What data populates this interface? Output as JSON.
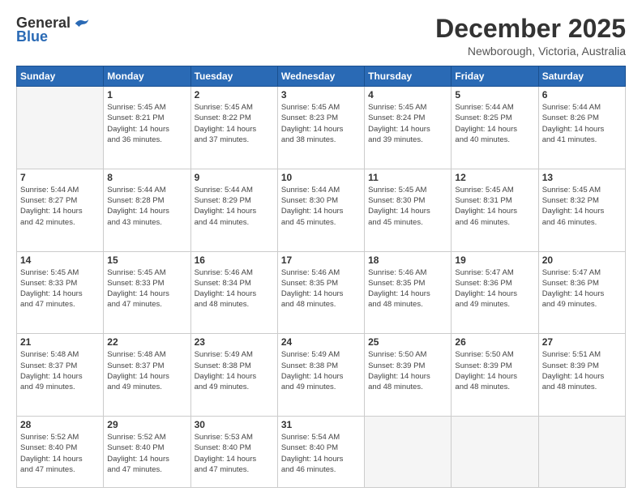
{
  "header": {
    "logo_general": "General",
    "logo_blue": "Blue",
    "month_title": "December 2025",
    "subtitle": "Newborough, Victoria, Australia"
  },
  "days_of_week": [
    "Sunday",
    "Monday",
    "Tuesday",
    "Wednesday",
    "Thursday",
    "Friday",
    "Saturday"
  ],
  "weeks": [
    [
      {
        "num": "",
        "info": ""
      },
      {
        "num": "1",
        "info": "Sunrise: 5:45 AM\nSunset: 8:21 PM\nDaylight: 14 hours\nand 36 minutes."
      },
      {
        "num": "2",
        "info": "Sunrise: 5:45 AM\nSunset: 8:22 PM\nDaylight: 14 hours\nand 37 minutes."
      },
      {
        "num": "3",
        "info": "Sunrise: 5:45 AM\nSunset: 8:23 PM\nDaylight: 14 hours\nand 38 minutes."
      },
      {
        "num": "4",
        "info": "Sunrise: 5:45 AM\nSunset: 8:24 PM\nDaylight: 14 hours\nand 39 minutes."
      },
      {
        "num": "5",
        "info": "Sunrise: 5:44 AM\nSunset: 8:25 PM\nDaylight: 14 hours\nand 40 minutes."
      },
      {
        "num": "6",
        "info": "Sunrise: 5:44 AM\nSunset: 8:26 PM\nDaylight: 14 hours\nand 41 minutes."
      }
    ],
    [
      {
        "num": "7",
        "info": "Sunrise: 5:44 AM\nSunset: 8:27 PM\nDaylight: 14 hours\nand 42 minutes."
      },
      {
        "num": "8",
        "info": "Sunrise: 5:44 AM\nSunset: 8:28 PM\nDaylight: 14 hours\nand 43 minutes."
      },
      {
        "num": "9",
        "info": "Sunrise: 5:44 AM\nSunset: 8:29 PM\nDaylight: 14 hours\nand 44 minutes."
      },
      {
        "num": "10",
        "info": "Sunrise: 5:44 AM\nSunset: 8:30 PM\nDaylight: 14 hours\nand 45 minutes."
      },
      {
        "num": "11",
        "info": "Sunrise: 5:45 AM\nSunset: 8:30 PM\nDaylight: 14 hours\nand 45 minutes."
      },
      {
        "num": "12",
        "info": "Sunrise: 5:45 AM\nSunset: 8:31 PM\nDaylight: 14 hours\nand 46 minutes."
      },
      {
        "num": "13",
        "info": "Sunrise: 5:45 AM\nSunset: 8:32 PM\nDaylight: 14 hours\nand 46 minutes."
      }
    ],
    [
      {
        "num": "14",
        "info": "Sunrise: 5:45 AM\nSunset: 8:33 PM\nDaylight: 14 hours\nand 47 minutes."
      },
      {
        "num": "15",
        "info": "Sunrise: 5:45 AM\nSunset: 8:33 PM\nDaylight: 14 hours\nand 47 minutes."
      },
      {
        "num": "16",
        "info": "Sunrise: 5:46 AM\nSunset: 8:34 PM\nDaylight: 14 hours\nand 48 minutes."
      },
      {
        "num": "17",
        "info": "Sunrise: 5:46 AM\nSunset: 8:35 PM\nDaylight: 14 hours\nand 48 minutes."
      },
      {
        "num": "18",
        "info": "Sunrise: 5:46 AM\nSunset: 8:35 PM\nDaylight: 14 hours\nand 48 minutes."
      },
      {
        "num": "19",
        "info": "Sunrise: 5:47 AM\nSunset: 8:36 PM\nDaylight: 14 hours\nand 49 minutes."
      },
      {
        "num": "20",
        "info": "Sunrise: 5:47 AM\nSunset: 8:36 PM\nDaylight: 14 hours\nand 49 minutes."
      }
    ],
    [
      {
        "num": "21",
        "info": "Sunrise: 5:48 AM\nSunset: 8:37 PM\nDaylight: 14 hours\nand 49 minutes."
      },
      {
        "num": "22",
        "info": "Sunrise: 5:48 AM\nSunset: 8:37 PM\nDaylight: 14 hours\nand 49 minutes."
      },
      {
        "num": "23",
        "info": "Sunrise: 5:49 AM\nSunset: 8:38 PM\nDaylight: 14 hours\nand 49 minutes."
      },
      {
        "num": "24",
        "info": "Sunrise: 5:49 AM\nSunset: 8:38 PM\nDaylight: 14 hours\nand 49 minutes."
      },
      {
        "num": "25",
        "info": "Sunrise: 5:50 AM\nSunset: 8:39 PM\nDaylight: 14 hours\nand 48 minutes."
      },
      {
        "num": "26",
        "info": "Sunrise: 5:50 AM\nSunset: 8:39 PM\nDaylight: 14 hours\nand 48 minutes."
      },
      {
        "num": "27",
        "info": "Sunrise: 5:51 AM\nSunset: 8:39 PM\nDaylight: 14 hours\nand 48 minutes."
      }
    ],
    [
      {
        "num": "28",
        "info": "Sunrise: 5:52 AM\nSunset: 8:40 PM\nDaylight: 14 hours\nand 47 minutes."
      },
      {
        "num": "29",
        "info": "Sunrise: 5:52 AM\nSunset: 8:40 PM\nDaylight: 14 hours\nand 47 minutes."
      },
      {
        "num": "30",
        "info": "Sunrise: 5:53 AM\nSunset: 8:40 PM\nDaylight: 14 hours\nand 47 minutes."
      },
      {
        "num": "31",
        "info": "Sunrise: 5:54 AM\nSunset: 8:40 PM\nDaylight: 14 hours\nand 46 minutes."
      },
      {
        "num": "",
        "info": ""
      },
      {
        "num": "",
        "info": ""
      },
      {
        "num": "",
        "info": ""
      }
    ]
  ]
}
